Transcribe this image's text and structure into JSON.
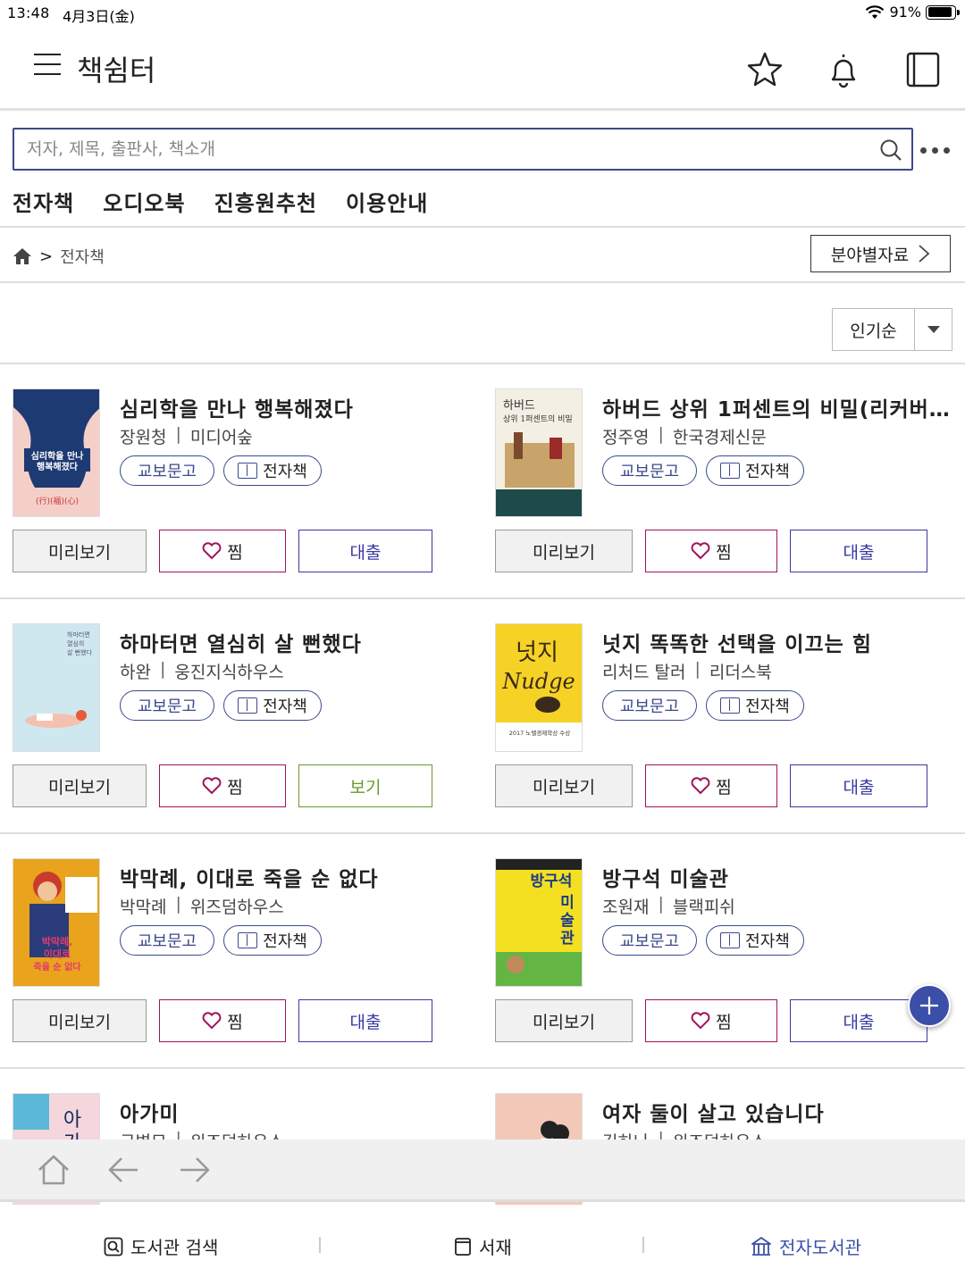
{
  "status": {
    "time": "13:48",
    "date": "4月3日(金)",
    "battery": "91%",
    "battery_level": 0.91
  },
  "header": {
    "title": "책쉼터",
    "icons": [
      "star-icon",
      "bell-icon",
      "bookshelf-icon"
    ]
  },
  "search": {
    "placeholder": "저자, 제목, 출판사, 책소개",
    "value": ""
  },
  "categories": [
    "전자책",
    "오디오북",
    "진흥원추천",
    "이용안내"
  ],
  "breadcrumb": {
    "current": "전자책",
    "separator": ">"
  },
  "field_button": {
    "label": "분야별자료"
  },
  "sort": {
    "selected": "인기순"
  },
  "labels": {
    "kyobo": "교보문고",
    "ebook": "전자책",
    "preview": "미리보기",
    "wish": "찜",
    "loan": "대출",
    "view": "보기"
  },
  "books": [
    {
      "title": "심리학을 만나 행복해졌다",
      "author": "장원청",
      "publisher": "미디어숲",
      "action": "대출"
    },
    {
      "title": "하버드 상위 1퍼센트의 비밀(리커버 …",
      "author": "정주영",
      "publisher": "한국경제신문",
      "action": "대출"
    },
    {
      "title": "하마터면 열심히 살 뻔했다",
      "author": "하완",
      "publisher": "웅진지식하우스",
      "action": "보기"
    },
    {
      "title": "넛지 똑똑한 선택을 이끄는 힘",
      "author": "리처드 탈러",
      "publisher": "리더스북",
      "action": "대출"
    },
    {
      "title": "박막례, 이대로 죽을 순 없다",
      "author": "박막례",
      "publisher": "위즈덤하우스",
      "action": "대출"
    },
    {
      "title": "방구석 미술관",
      "author": "조원재",
      "publisher": "블랙피쉬",
      "action": "대출"
    },
    {
      "title": "아가미",
      "author": "구병모",
      "publisher": "위즈덤하우스",
      "action": ""
    },
    {
      "title": "여자 둘이 살고 있습니다",
      "author": "김하나",
      "publisher": "위즈덤하우스",
      "action": ""
    }
  ],
  "tabs": [
    {
      "label": "도서관 검색",
      "icon": "search-book-icon"
    },
    {
      "label": "서재",
      "icon": "library-icon"
    },
    {
      "label": "전자도서관",
      "icon": "building-icon",
      "active": true
    }
  ],
  "colors": {
    "accent": "#3b4fa8",
    "wish": "#a0145a",
    "view": "#6a9a2a"
  }
}
